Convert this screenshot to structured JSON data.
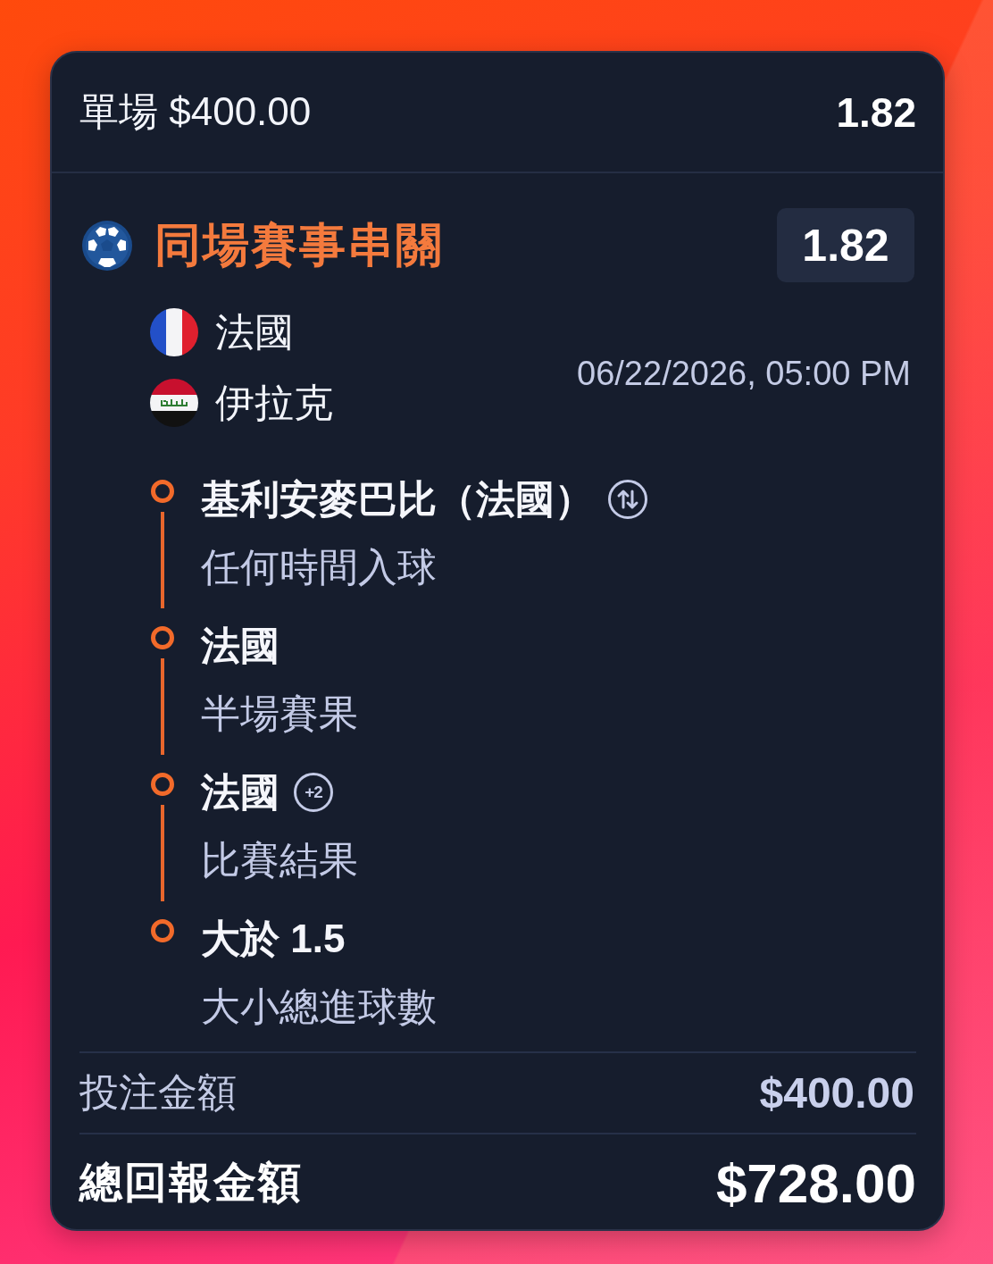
{
  "header": {
    "title": "單場 $400.00",
    "odds": "1.82"
  },
  "bet": {
    "title": "同場賽事串關",
    "odds": "1.82",
    "teams": [
      {
        "name": "法國",
        "kind": "france"
      },
      {
        "name": "伊拉克",
        "kind": "iraq"
      }
    ],
    "kickoff": "06/22/2026, 05:00 PM",
    "legs": [
      {
        "selection": "基利安麥巴比（法國）",
        "market": "任何時間入球",
        "extra": {
          "kind": "swap"
        }
      },
      {
        "selection": "法國",
        "market": "半場賽果"
      },
      {
        "selection": "法國",
        "market": "比賽結果",
        "extra": {
          "kind": "count",
          "text": "+2"
        }
      },
      {
        "selection": "大於 1.5",
        "market": "大小總進球數"
      }
    ]
  },
  "summary": {
    "stake_label": "投注金額",
    "stake": "$400.00",
    "return_label": "總回報金額",
    "return": "$728.00"
  }
}
